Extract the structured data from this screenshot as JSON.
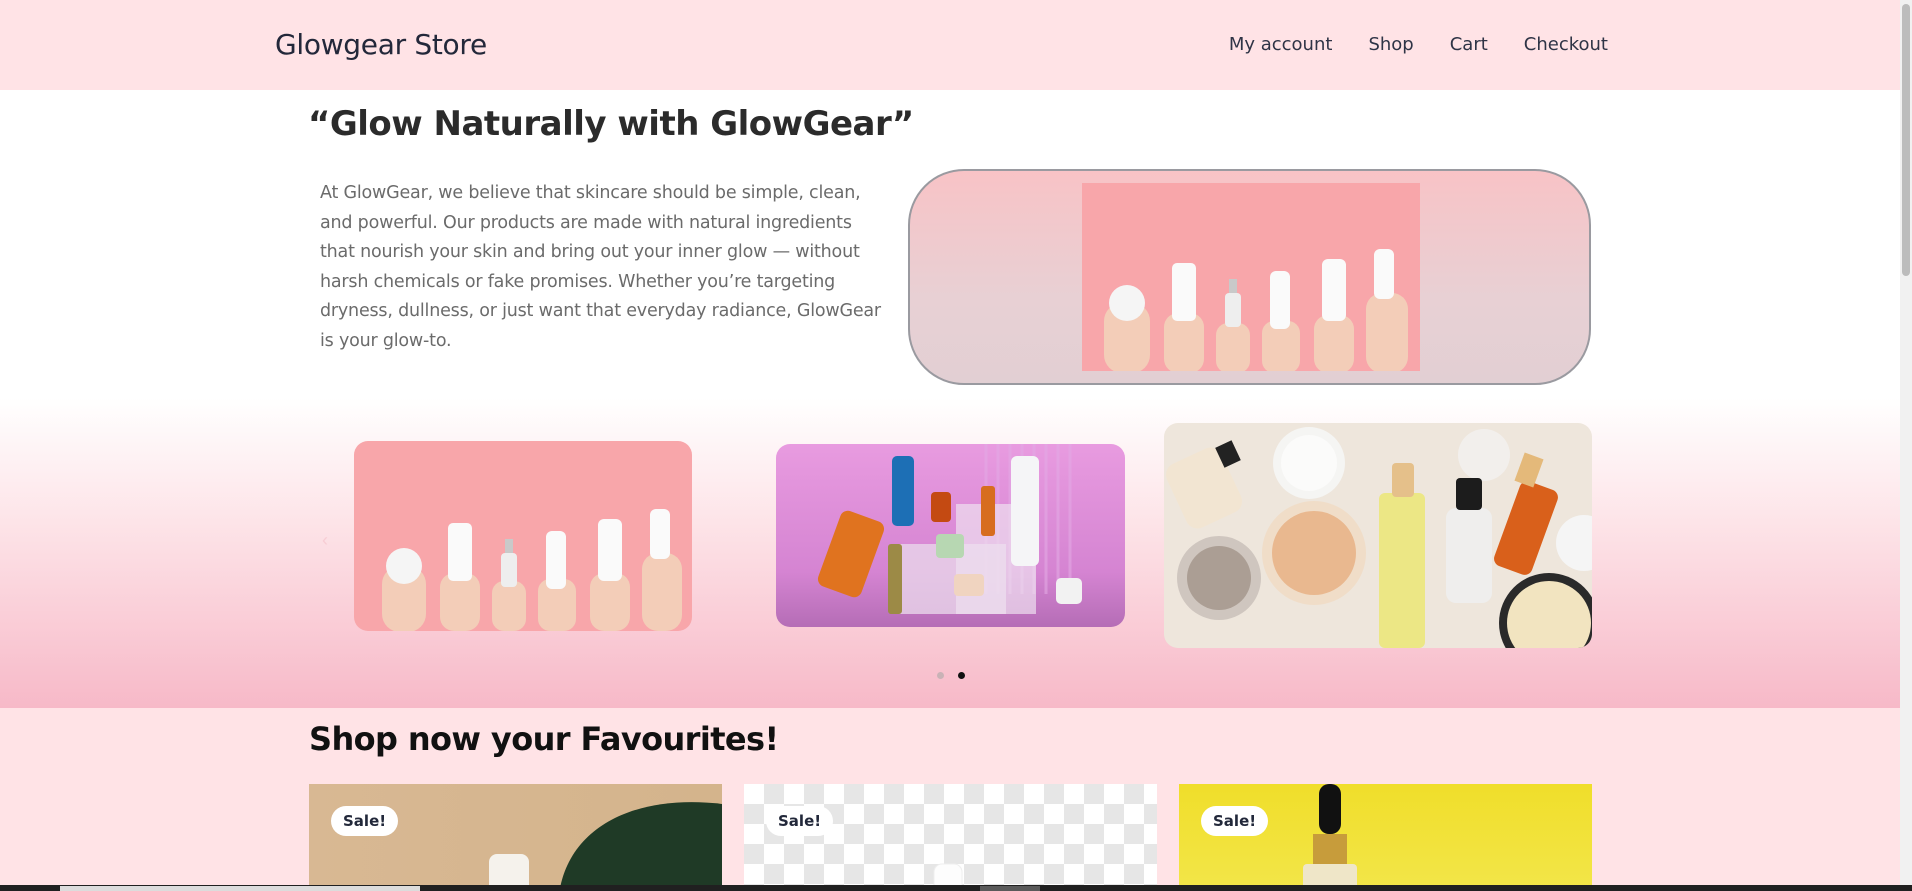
{
  "header": {
    "brand": "Glowgear Store",
    "nav": [
      "My account",
      "Shop",
      "Cart",
      "Checkout"
    ]
  },
  "hero": {
    "title": "“Glow Naturally with GlowGear”",
    "text": "At GlowGear, we believe that skincare should be simple, clean, and powerful. Our products are made with natural ingredients that nourish your skin and bring out your inner glow — without harsh chemicals or fake promises. Whether you’re targeting dryness, dullness, or just want that everyday radiance, GlowGear is your glow-to."
  },
  "carousel": {
    "prev_arrow": "‹",
    "dots": 2,
    "active_dot": 2
  },
  "shop": {
    "title": "Shop now your Favourites!",
    "cards": [
      {
        "badge": "Sale!"
      },
      {
        "badge": "Sale!"
      },
      {
        "badge": "Sale!"
      }
    ]
  },
  "colors": {
    "header_bg": "#ffe3e6",
    "accent_pink": "#f8a6aa",
    "text_dark": "#23283a"
  }
}
